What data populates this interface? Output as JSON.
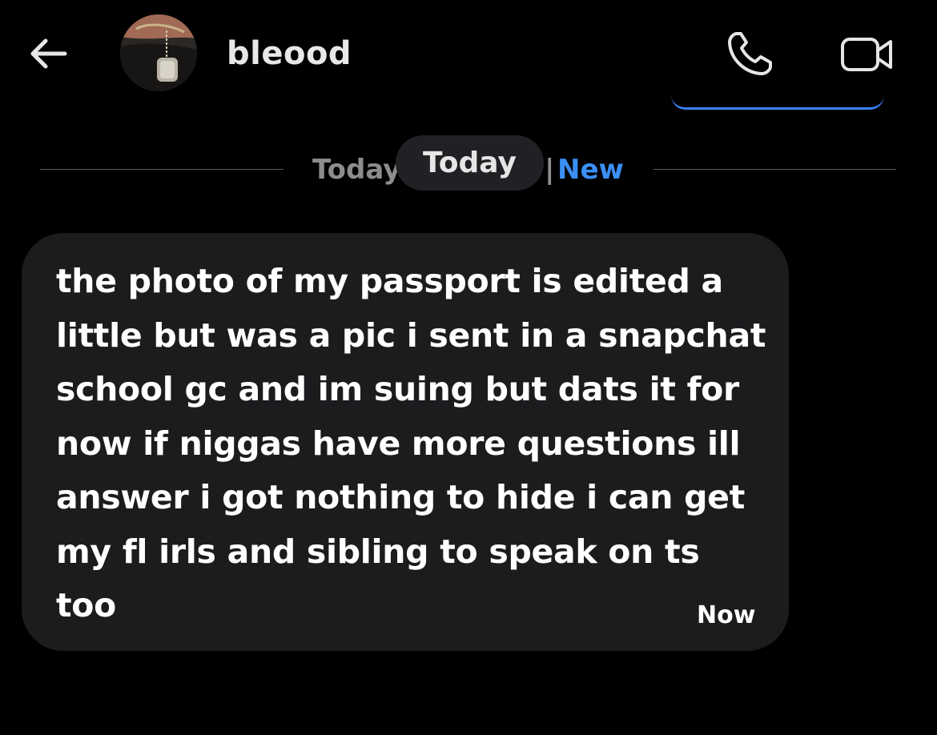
{
  "header": {
    "username": "bleood",
    "back_icon": "arrow-left-icon",
    "call_icon": "phone-icon",
    "video_icon": "video-camera-icon"
  },
  "divider": {
    "today_label": "Today",
    "separator": "|",
    "new_label": "New",
    "date_pill": "Today"
  },
  "message": {
    "text": "the photo of my passport is edited a\nlittle but was a pic i sent in a snapchat\nschool gc and im suing but dats it for\nnow if niggas have more questions ill\nanswer i got nothing to hide i can get\nmy fl irls and sibling to speak on ts\ntoo",
    "time": "Now"
  },
  "colors": {
    "background": "#000000",
    "bubble": "#1c1c1f",
    "accent": "#3b8ff5",
    "muted_text": "#8d8d8d"
  }
}
